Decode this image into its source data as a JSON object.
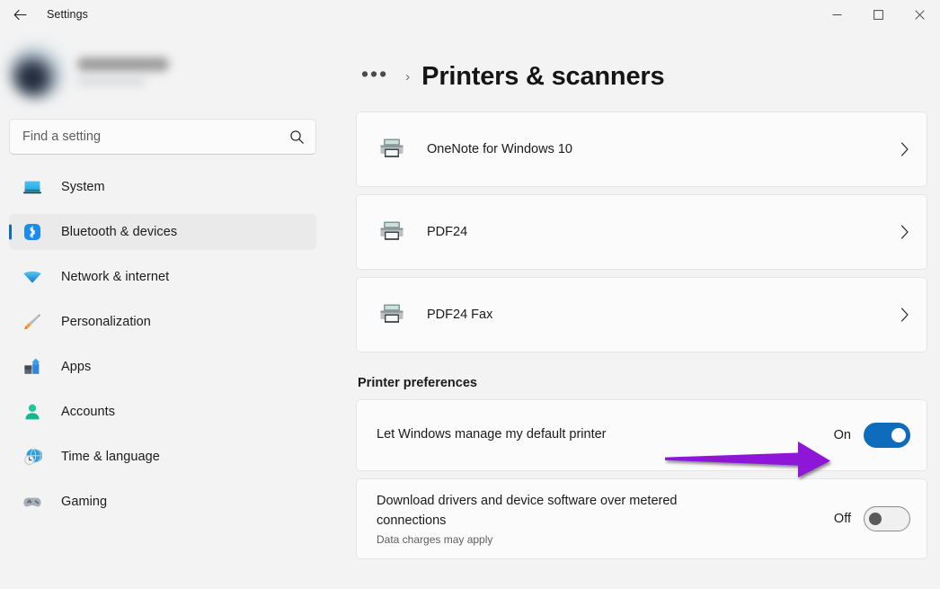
{
  "window": {
    "title": "Settings",
    "back_icon": "back-arrow-icon",
    "minimize_label": "Minimize",
    "maximize_label": "Maximize",
    "close_label": "Close"
  },
  "sidebar": {
    "profile": {
      "name": "",
      "subtitle": "",
      "avatar_icon": "user-avatar"
    },
    "search": {
      "placeholder": "Find a setting",
      "value": "",
      "icon": "search-icon"
    },
    "items": [
      {
        "label": "System",
        "icon": "system-icon",
        "active": false
      },
      {
        "label": "Bluetooth & devices",
        "icon": "bluetooth-icon",
        "active": true
      },
      {
        "label": "Network & internet",
        "icon": "network-icon",
        "active": false
      },
      {
        "label": "Personalization",
        "icon": "personalization-icon",
        "active": false
      },
      {
        "label": "Apps",
        "icon": "apps-icon",
        "active": false
      },
      {
        "label": "Accounts",
        "icon": "accounts-icon",
        "active": false
      },
      {
        "label": "Time & language",
        "icon": "time-language-icon",
        "active": false
      },
      {
        "label": "Gaming",
        "icon": "gaming-icon",
        "active": false
      }
    ]
  },
  "main": {
    "breadcrumb": {
      "overflow": "•••",
      "separator": "›",
      "current": "Printers & scanners"
    },
    "printers": [
      {
        "name": "OneNote for Windows 10",
        "icon": "printer-icon",
        "chevron": "chevron-right-icon"
      },
      {
        "name": "PDF24",
        "icon": "printer-icon",
        "chevron": "chevron-right-icon"
      },
      {
        "name": "PDF24 Fax",
        "icon": "printer-icon",
        "chevron": "chevron-right-icon"
      }
    ],
    "preferences": {
      "heading": "Printer preferences",
      "rows": [
        {
          "label": "Let Windows manage my default printer",
          "sublabel": "",
          "state": "On",
          "on": true
        },
        {
          "label": "Download drivers and device software over metered connections",
          "sublabel": "Data charges may apply",
          "state": "Off",
          "on": false
        }
      ]
    }
  },
  "annotation": {
    "type": "arrow",
    "color": "#8e13d6",
    "points_to": "Let Windows manage my default printer toggle"
  },
  "colors": {
    "accent": "#0f6cbd",
    "window_background": "#f3f3f3",
    "card_background": "#fbfbfb",
    "card_border": "#e5e5e5",
    "selected_nav": "#eaeaea",
    "annotation_purple": "#8e13d6"
  }
}
